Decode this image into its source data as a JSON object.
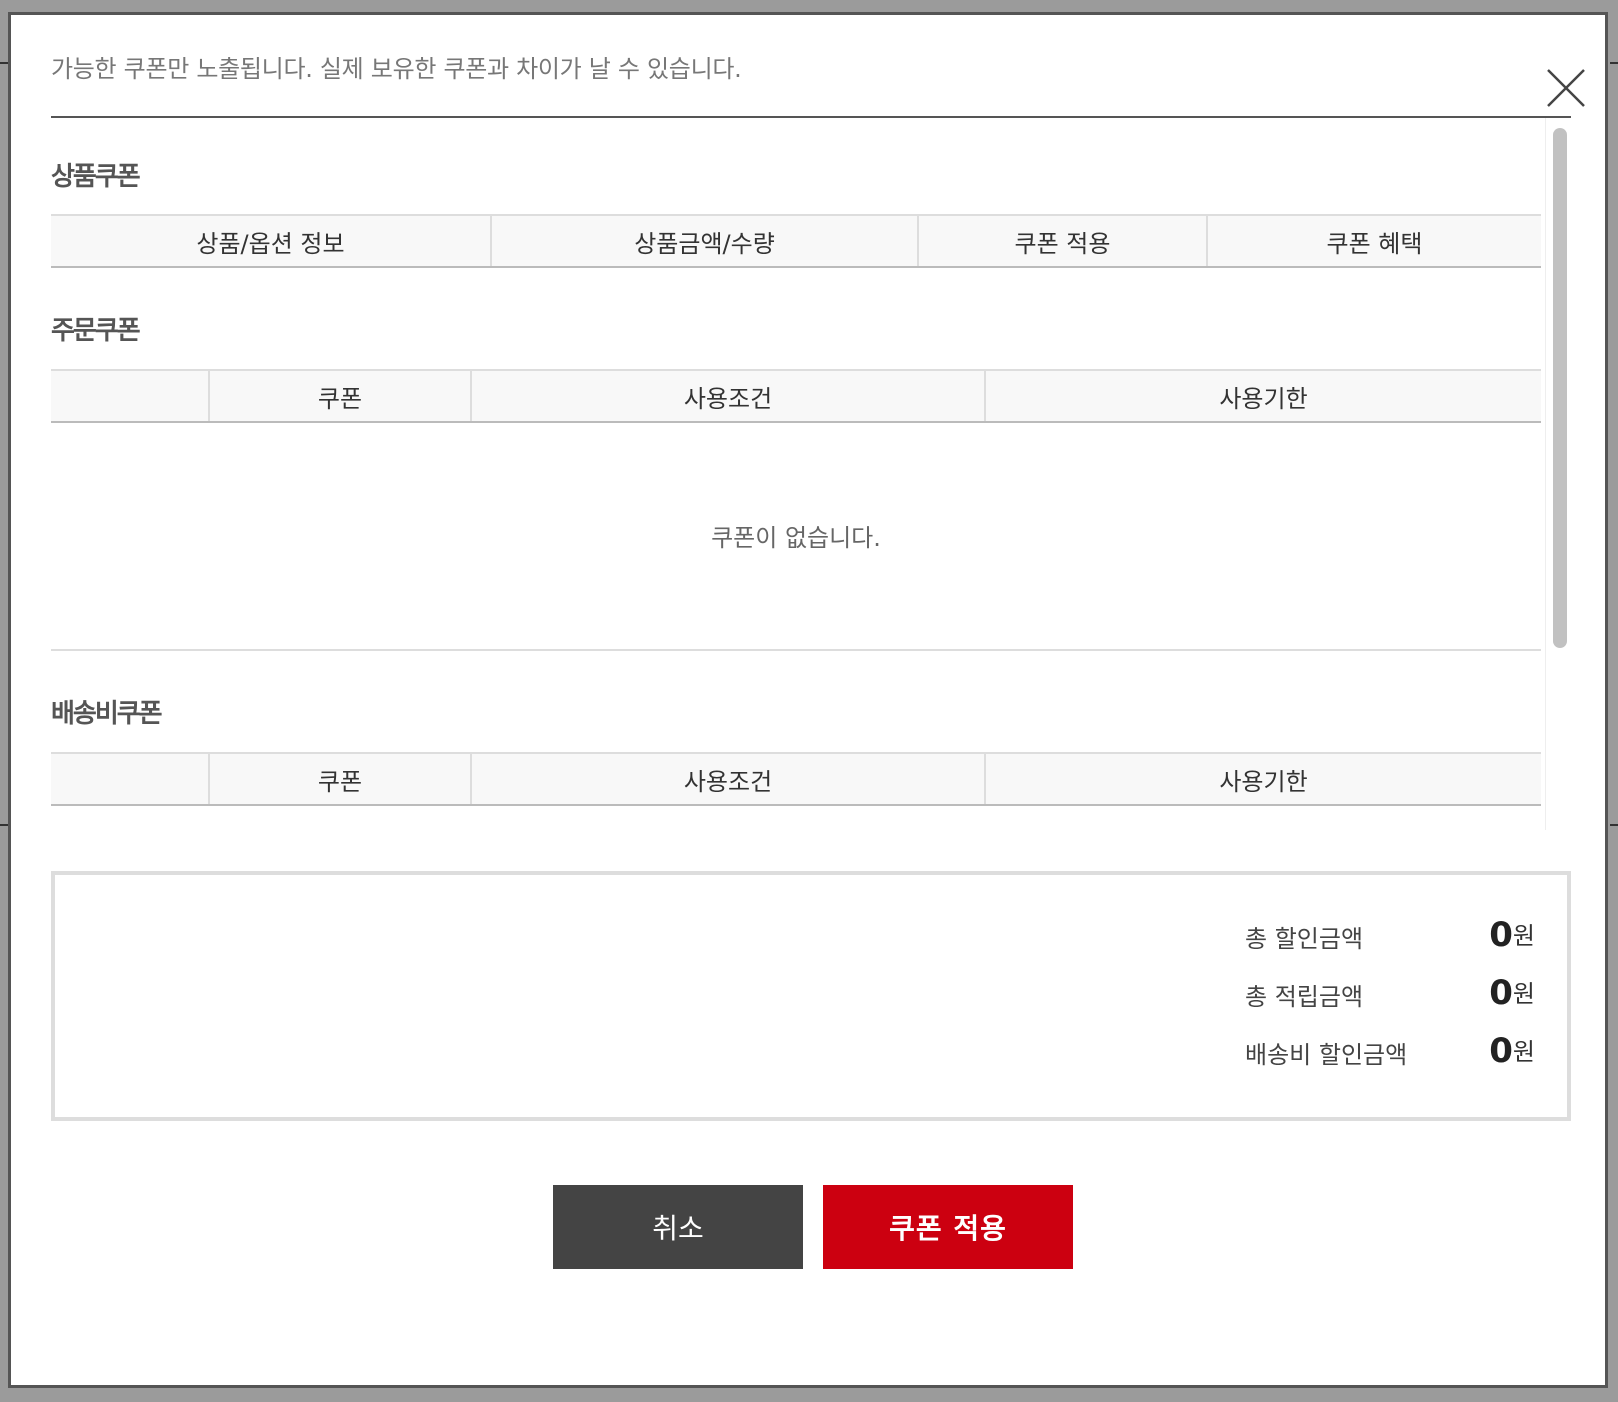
{
  "modal": {
    "notice": "가능한 쿠폰만 노출됩니다. 실제 보유한 쿠폰과 차이가 날 수 있습니다."
  },
  "product_coupon": {
    "title": "상품쿠폰",
    "columns": [
      "상품/옵션 정보",
      "상품금액/수량",
      "쿠폰 적용",
      "쿠폰 혜택"
    ]
  },
  "order_coupon": {
    "title": "주문쿠폰",
    "columns": [
      "",
      "쿠폰",
      "사용조건",
      "사용기한"
    ],
    "empty_message": "쿠폰이 없습니다."
  },
  "shipping_coupon": {
    "title": "배송비쿠폰",
    "columns": [
      "",
      "쿠폰",
      "사용조건",
      "사용기한"
    ]
  },
  "summary": {
    "total_discount": {
      "label": "총 할인금액",
      "amount": "0",
      "unit": "원"
    },
    "total_points": {
      "label": "총 적립금액",
      "amount": "0",
      "unit": "원"
    },
    "shipping_discount": {
      "label": "배송비 할인금액",
      "amount": "0",
      "unit": "원"
    }
  },
  "buttons": {
    "cancel_label": "취소",
    "apply_label": "쿠폰 적용"
  },
  "colors": {
    "apply_button": "#cc0010",
    "cancel_button": "#444444"
  }
}
